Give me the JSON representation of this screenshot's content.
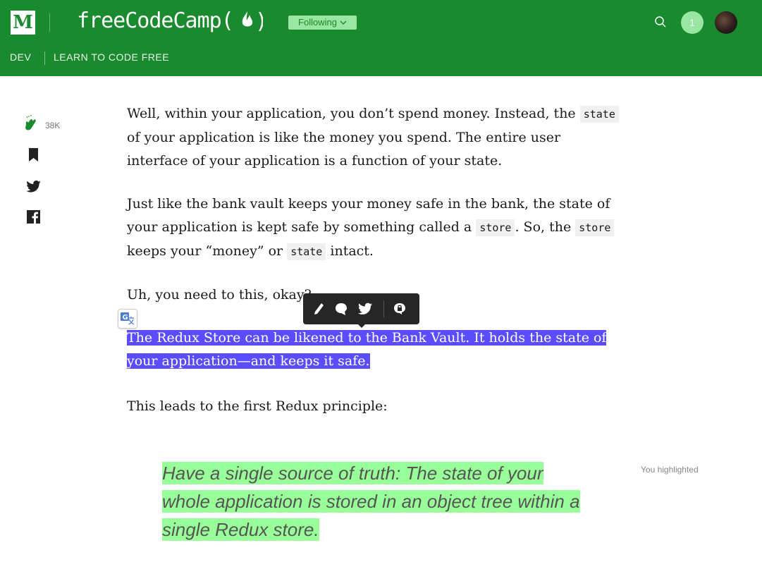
{
  "header": {
    "logo": "M",
    "publication": "freeCodeCamp(",
    "publication_close": ")",
    "follow_label": "Following",
    "notification_count": "1",
    "subnav": [
      "DEV",
      "LEARN TO CODE FREE"
    ]
  },
  "sidebar": {
    "clap_count": "38K"
  },
  "article": {
    "p1_a": "Well, within your application, you don’t spend money. Instead, the ",
    "p1_code": "state",
    "p1_b": " of your application is like the money you spend. The entire user interface of your application is a function of your state.",
    "p2_a": "Just like the bank vault keeps your money safe in the bank, the state of your application is kept safe by something called a ",
    "p2_code1": "store",
    "p2_b": ". So, the ",
    "p2_code2": "store",
    "p2_c": " keeps your “money” or ",
    "p2_code3": "state",
    "p2_d": " intact.",
    "p3": "Uh, you need to this, okay?",
    "selected": "The Redux Store can be likened to the Bank Vault. It holds the state of your application—and keeps it safe.",
    "p4": "This leads to the first Redux principle:",
    "quote": "Have a single source of truth: The state of your whole application is stored in an object tree within a single Redux store.",
    "you_highlighted": "You highlighted"
  },
  "colors": {
    "brand": "#1a8a2e",
    "accent_light": "#99e6a3",
    "selection": "#5b4cff",
    "highlight": "#99ff99"
  },
  "icons": [
    "fire-logo-icon",
    "chevron-down-icon",
    "search-icon",
    "clap-icon",
    "bookmark-icon",
    "twitter-icon",
    "facebook-icon",
    "pencil-icon",
    "comment-icon",
    "lock-icon",
    "translate-icon"
  ]
}
